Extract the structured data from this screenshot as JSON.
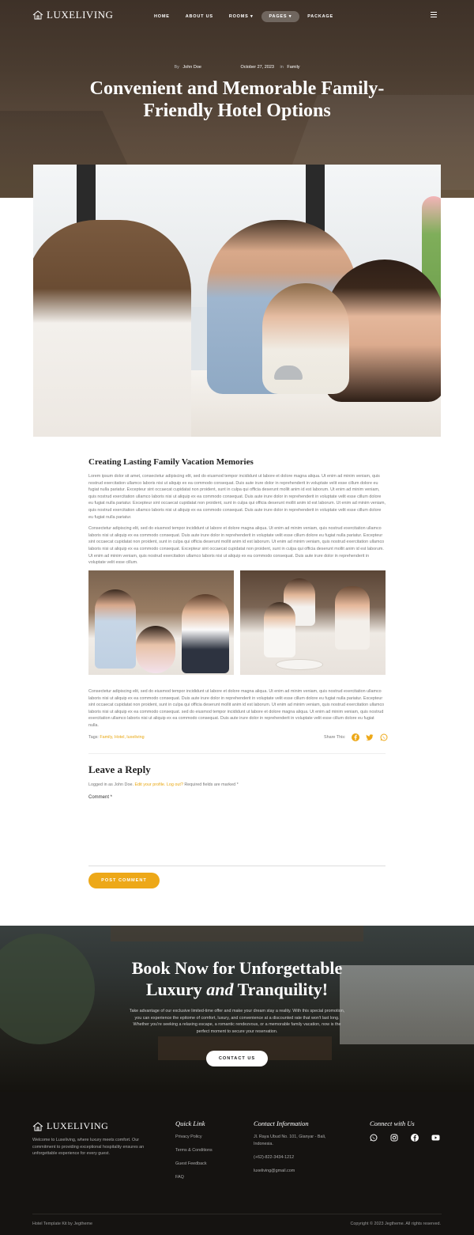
{
  "brand": {
    "name": "LUXELIVING"
  },
  "nav": {
    "items": [
      {
        "label": "HOME"
      },
      {
        "label": "ABOUT US"
      },
      {
        "label": "ROOMS"
      },
      {
        "label": "PAGES"
      },
      {
        "label": "PACKAGE"
      }
    ],
    "active_index": 3
  },
  "post": {
    "by_label": "By",
    "author": "John Doe",
    "date": "October 27, 2023",
    "in_label": "in",
    "category": "Family",
    "title": "Convenient and Memorable Family-Friendly Hotel Options",
    "section_heading": "Creating Lasting Family Vacation Memories",
    "paragraph_1": "Lorem ipsum dolor sit amet, consectetur adipiscing elit, sed do eiusmod tempor incididunt ut labore et dolore magna aliqua. Ut enim ad minim veniam, quis nostrud exercitation ullamco laboris nisi ut aliquip ex ea commodo consequat. Duis aute irure dolor in reprehenderit in voluptate velit esse cillum dolore eu fugiat nulla pariatur. Excepteur sint occaecat cupidatat non proident, sunt in culpa qui officia deserunt mollit anim id est laborum. Ut enim ad minim veniam, quis nostrud exercitation ullamco laboris nisi ut aliquip ex ea commodo consequat. Duis aute irure dolor in reprehenderit in voluptate velit esse cillum dolore eu fugiat nulla pariatur. Excepteur sint occaecat cupidatat non proident, sunt in culpa qui officia deserunt mollit anim id est laborum. Ut enim ad minim veniam, quis nostrud exercitation ullamco laboris nisi ut aliquip ex ea commodo consequat. Duis aute irure dolor in reprehenderit in voluptate velit esse cillum dolore eu fugiat nulla pariatur.",
    "paragraph_2": "Consectetur adipiscing elit, sed do eiusmod tempor incididunt ut labore et dolore magna aliqua. Ut enim ad minim veniam, quis nostrud exercitation ullamco laboris nisi ut aliquip ex ea commodo consequat. Duis aute irure dolor in reprehenderit in voluptate velit esse cillum dolore eu fugiat nulla pariatur. Excepteur sint occaecat cupidatat non proident, sunt in culpa qui officia deserunt mollit anim id est laborum. Ut enim ad minim veniam, quis nostrud exercitation ullamco laboris nisi ut aliquip ex ea commodo consequat. Excepteur sint occaecat cupidatat non proident, sunt in culpa qui officia deserunt mollit anim id est laborum. Ut enim ad minim veniam, quis nostrud exercitation ullamco laboris nisi ut aliquip ex ea commodo consequat. Duis aute irure dolor in reprehenderit in voluptate velit esse cillum.",
    "paragraph_3": "Consectetur adipiscing elit, sed do eiusmod tempor incididunt ut labore et dolore magna aliqua. Ut enim ad minim veniam, quis nostrud exercitation ullamco laboris nisi ut aliquip ex ea commodo consequat. Duis aute irure dolor in reprehenderit in voluptate velit esse cillum dolore eu fugiat nulla pariatur. Excepteur sint occaecat cupidatat non proident, sunt in culpa qui officia deserunt mollit anim id est laborum. Ut enim ad minim veniam, quis nostrud exercitation ullamco laboris nisi ut aliquip ex ea commodo consequat. sed do eiusmod tempor incididunt ut labore et dolore magna aliqua. Ut enim ad minim veniam, quis nostrud exercitation ullamco laboris nisi ut aliquip ex ea commodo consequat. Duis aute irure dolor in reprehenderit in voluptate velit esse cillum dolore eu fugiat nulla.",
    "tags_label": "Tags:",
    "tags": "Family, Hotel, luxeliving",
    "share_label": "Share This:"
  },
  "reply": {
    "title": "Leave a Reply",
    "logged_in_prefix": "Logged in as John Doe.",
    "edit_profile": "Edit your profile.",
    "log_out": "Log out?",
    "required_note": "Required fields are marked *",
    "comment_label": "Comment *",
    "post_button": "POST COMMENT"
  },
  "cta": {
    "title_line1": "Book Now for Unforgettable",
    "title_line2_pre": "Luxury ",
    "title_line2_em": "and",
    "title_line2_post": " Tranquility!",
    "text": "Take advantage of our exclusive limited-time offer and make your dream stay a reality. With this special promotion, you can experience the epitome of comfort, luxury, and convenience at a discounted rate that won't last long. Whether you're seeking a relaxing escape, a romantic rendezvous, or a memorable family vacation, now is the perfect moment to secure your reservation.",
    "button": "CONTACT US"
  },
  "footer": {
    "about": "Welcome to Luxeliving, where luxury meets comfort. Our commitment to providing exceptional hospitality ensures an unforgettable experience for every guest.",
    "quick_link_title": "Quick Link",
    "quick_links": [
      "Privacy Policy",
      "Terms & Conditions",
      "Guest Feedback",
      "FAQ"
    ],
    "contact_title": "Contact Information",
    "address": "Jl. Raya Ubud No. 101, Gianyar - Bali, Indonesia.",
    "phone": "(+62)-822-3434-1212",
    "email": "luxeliving@gmail.com",
    "connect_title": "Connect with Us",
    "social": [
      "whatsapp-icon",
      "instagram-icon",
      "facebook-icon",
      "youtube-icon"
    ],
    "credit": "Hotel Template Kit by Jegtheme",
    "copyright": "Copyright © 2023 Jegtheme. All rights reserved."
  },
  "colors": {
    "accent": "#eda818",
    "dark": "#151311",
    "hero": "#4a3c30"
  }
}
